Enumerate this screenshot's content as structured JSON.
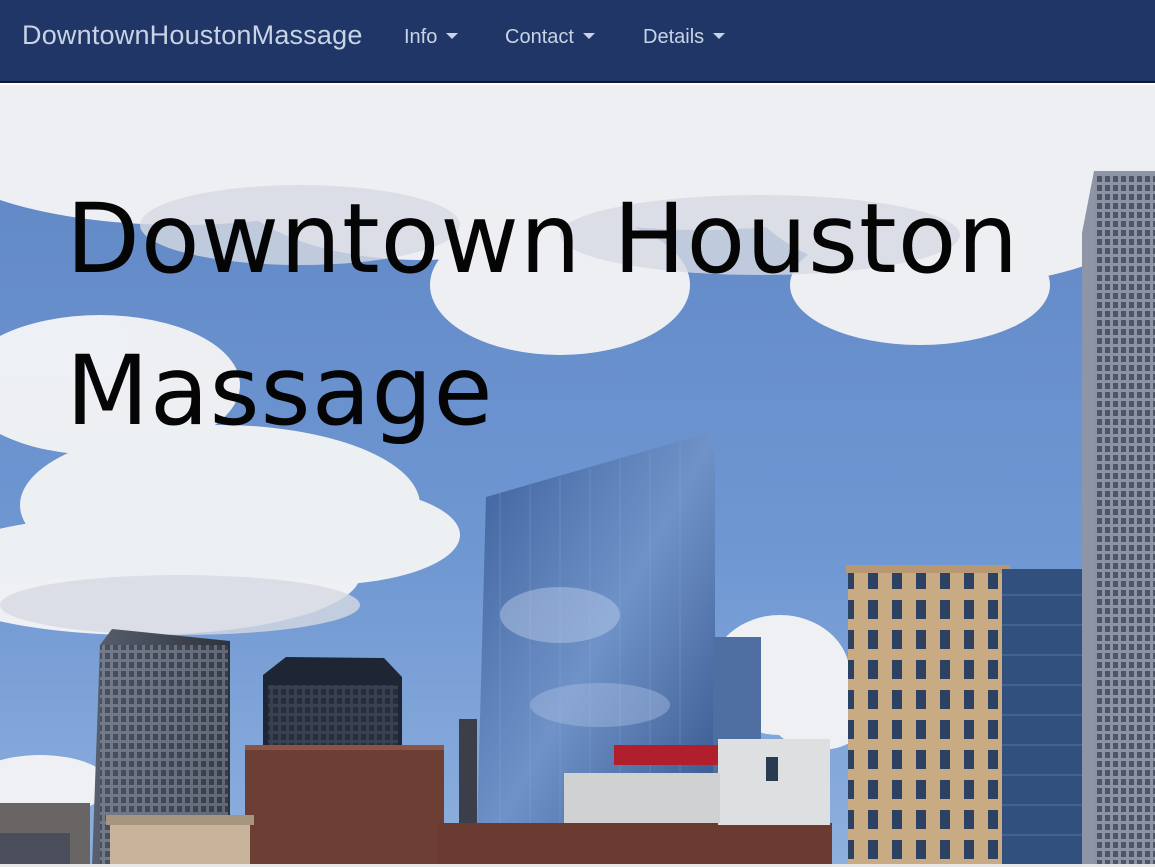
{
  "navbar": {
    "brand": "DowntownHoustonMassage",
    "items": [
      {
        "label": "Info"
      },
      {
        "label": "Contact"
      },
      {
        "label": "Details"
      }
    ],
    "background": "#1f3666",
    "text_color": "#c9d3e6"
  },
  "hero": {
    "title": "Downtown Houston Massage",
    "image": "downtown-houston-skyline-photo"
  }
}
